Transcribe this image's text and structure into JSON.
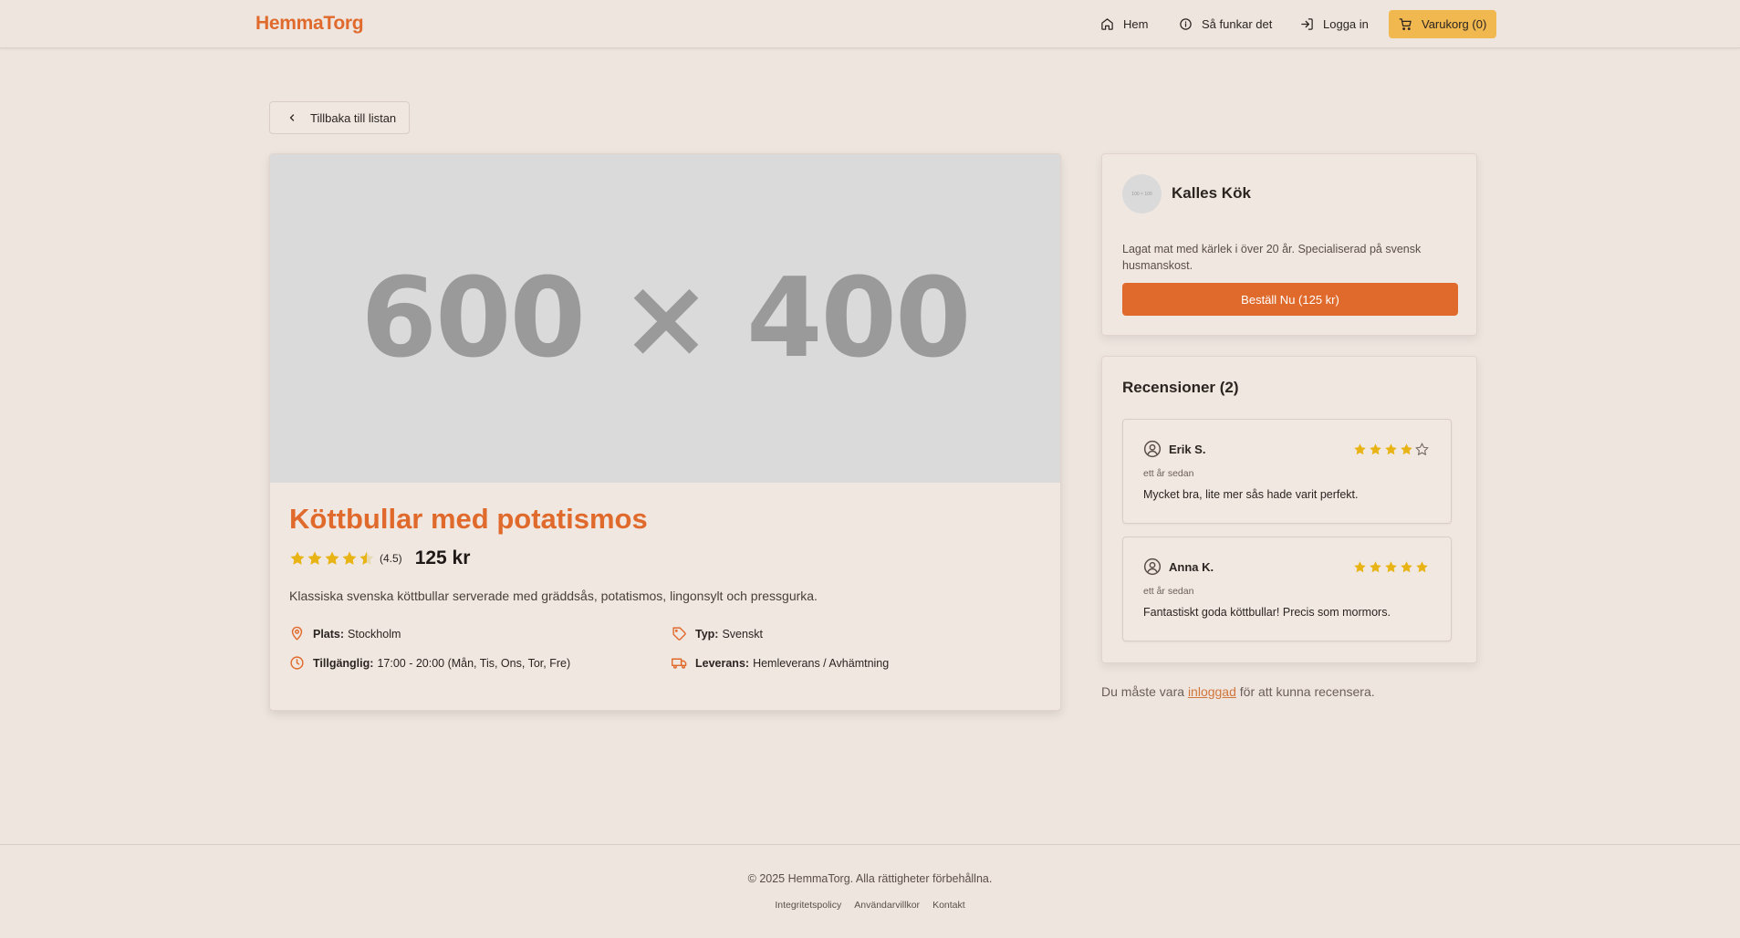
{
  "header": {
    "logo": "HemmaTorg",
    "nav": {
      "home": "Hem",
      "how_it_works": "Så funkar det",
      "login": "Logga in",
      "cart": "Varukorg (0)"
    }
  },
  "back_button": "Tillbaka till listan",
  "product": {
    "image_placeholder": "600 × 400",
    "title": "Köttbullar med potatismos",
    "rating": 4.5,
    "rating_label": "(4.5)",
    "price": "125 kr",
    "description": "Klassiska svenska köttbullar serverade med gräddsås, potatismos, lingonsylt och pressgurka.",
    "details": {
      "location_label": "Plats:",
      "location": "Stockholm",
      "type_label": "Typ:",
      "type": "Svenskt",
      "available_label": "Tillgänglig:",
      "available": "17:00 - 20:00 (Mån, Tis, Ons, Tor, Fre)",
      "delivery_label": "Leverans:",
      "delivery": "Hemleverans / Avhämtning"
    }
  },
  "seller": {
    "avatar_placeholder": "100 × 100",
    "name": "Kalles Kök",
    "description": "Lagat mat med kärlek i över 20 år. Specialiserad på svensk husmanskost.",
    "order_button": "Beställ Nu (125 kr)"
  },
  "reviews": {
    "title": "Recensioner (2)",
    "items": [
      {
        "user": "Erik S.",
        "rating": 4,
        "time": "ett år sedan",
        "text": "Mycket bra, lite mer sås hade varit perfekt."
      },
      {
        "user": "Anna K.",
        "rating": 5,
        "time": "ett år sedan",
        "text": "Fantastiskt goda köttbullar! Precis som mormors."
      }
    ]
  },
  "login_note": {
    "before": "Du måste vara ",
    "link": "inloggad",
    "after": " för att kunna recensera."
  },
  "footer": {
    "copyright": "© 2025 HemmaTorg. Alla rättigheter förbehållna.",
    "links": [
      "Integritetspolicy",
      "Användarvillkor",
      "Kontakt"
    ]
  },
  "colors": {
    "accent": "#e06a2c",
    "cart": "#f1b84f",
    "star": "#e8b415",
    "background": "#efe5df"
  }
}
